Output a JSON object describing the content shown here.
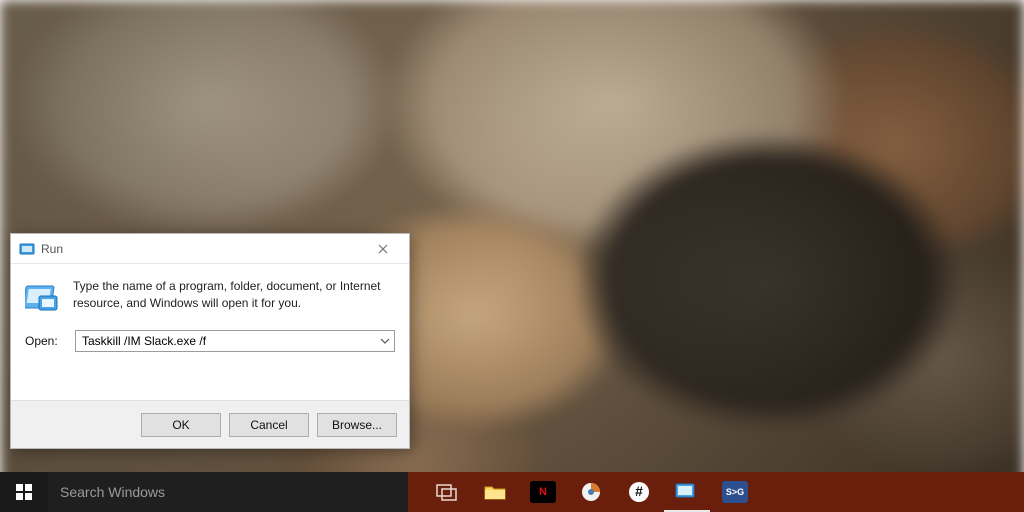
{
  "run_dialog": {
    "title": "Run",
    "description": "Type the name of a program, folder, document, or Internet resource, and Windows will open it for you.",
    "open_label": "Open:",
    "open_value": "Taskkill /IM Slack.exe /f",
    "buttons": {
      "ok": "OK",
      "cancel": "Cancel",
      "browse": "Browse..."
    }
  },
  "taskbar": {
    "search_placeholder": "Search Windows",
    "items": [
      {
        "name": "task-view",
        "label": ""
      },
      {
        "name": "file-explorer",
        "label": ""
      },
      {
        "name": "netflix",
        "label": "N"
      },
      {
        "name": "app-circle",
        "label": ""
      },
      {
        "name": "slack",
        "label": ""
      },
      {
        "name": "run-app",
        "label": ""
      },
      {
        "name": "sourcetree",
        "label": "S>G"
      }
    ]
  },
  "colors": {
    "taskbar_bg": "#6a1f0c",
    "start_bg": "#1a1a1a",
    "search_bg": "#1f1f1f",
    "dialog_btn_bg": "#e1e1e1"
  }
}
